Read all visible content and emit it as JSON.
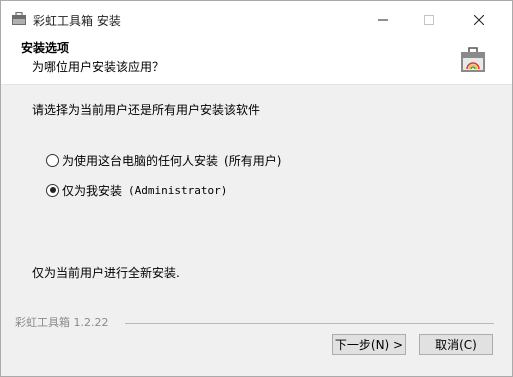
{
  "window": {
    "title": "彩虹工具箱 安装",
    "icons": {
      "app": "toolbox-icon",
      "minimize": "minimize-icon",
      "maximize": "maximize-icon",
      "close": "close-icon"
    }
  },
  "header": {
    "title": "安装选项",
    "subtitle": "为哪位用户安装该应用？",
    "icon": "toolbox-icon"
  },
  "body": {
    "prompt": "请选择为当前用户还是所有用户安装该软件",
    "options": [
      {
        "label": "为使用这台电脑的任何人安装",
        "suffix": "(所有用户)",
        "selected": false
      },
      {
        "label": "仅为我安装",
        "suffix": "(Administrator)",
        "selected": true
      }
    ],
    "note": "仅为当前用户进行全新安装."
  },
  "footer": {
    "brand": "彩虹工具箱 1.2.22",
    "next_label": "下一步(N) >",
    "cancel_label": "取消(C)"
  },
  "colors": {
    "accent": "#0078d7",
    "brand_text": "#8a8a8a"
  }
}
